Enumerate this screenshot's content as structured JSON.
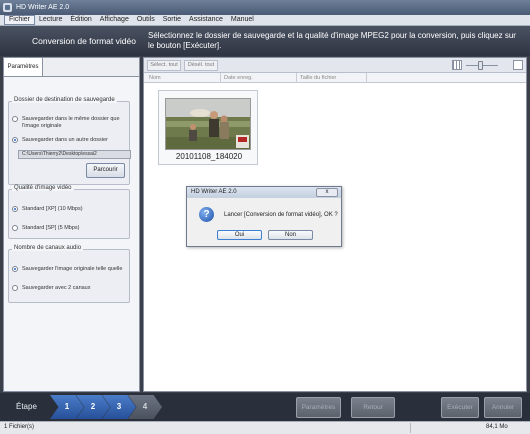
{
  "window": {
    "title": "HD Writer AE 2.0"
  },
  "menu": [
    "Fichier",
    "Lecture",
    "Édition",
    "Affichage",
    "Outils",
    "Sortie",
    "Assistance",
    "Manuel"
  ],
  "header": {
    "title": "Conversion de format vidéo",
    "instruction": "Sélectionnez le dossier de sauvegarde et la qualité d'image MPEG2 pour la conversion, puis cliquez sur le bouton [Exécuter]."
  },
  "left": {
    "tab": "Paramètres",
    "dest_group": {
      "title": "Dossier de destination de sauvegarde",
      "option_same": "Sauvegarder dans le même dossier que l'image originale",
      "option_other": "Sauvegarder dans un autre dossier",
      "path": "C:\\Users\\Thierry2\\Desktop\\essai2",
      "browse": "Parcourir"
    },
    "quality_group": {
      "title": "Qualité d'image vidéo",
      "option_xp": "Standard [XP] (10 Mbps)",
      "option_sp": "Standard [SP] (5 Mbps)"
    },
    "audio_group": {
      "title": "Nombre de canaux audio",
      "option_keep": "Sauvegarder l'image originale telle quelle",
      "option_2ch": "Sauvegarder avec 2 canaux"
    }
  },
  "toolbar": {
    "select_all": "Sélect. tout",
    "deselect_all": "Désél. tout"
  },
  "columns": [
    "Nom",
    "Date enreg.",
    "Taille du fichier"
  ],
  "thumbnail": {
    "label": "20101108_184020"
  },
  "dialog": {
    "title": "HD Writer AE 2.0",
    "close": "x",
    "message": "Lancer [Conversion de format vidéo], OK ?",
    "ok": "Oui",
    "cancel": "Non"
  },
  "steps": {
    "label": "Étape",
    "items": [
      "1",
      "2",
      "3",
      "4"
    ]
  },
  "actions": {
    "params": "Paramètres",
    "back": "Retour",
    "execute": "Exécuter",
    "cancel": "Annuler"
  },
  "status": {
    "files": "1 Fichier(s)",
    "size": "84,1 Mo"
  },
  "colors": {
    "accent": "#2a62c9",
    "step_active": "#3a66b0",
    "header_bg": "#3a404d"
  }
}
